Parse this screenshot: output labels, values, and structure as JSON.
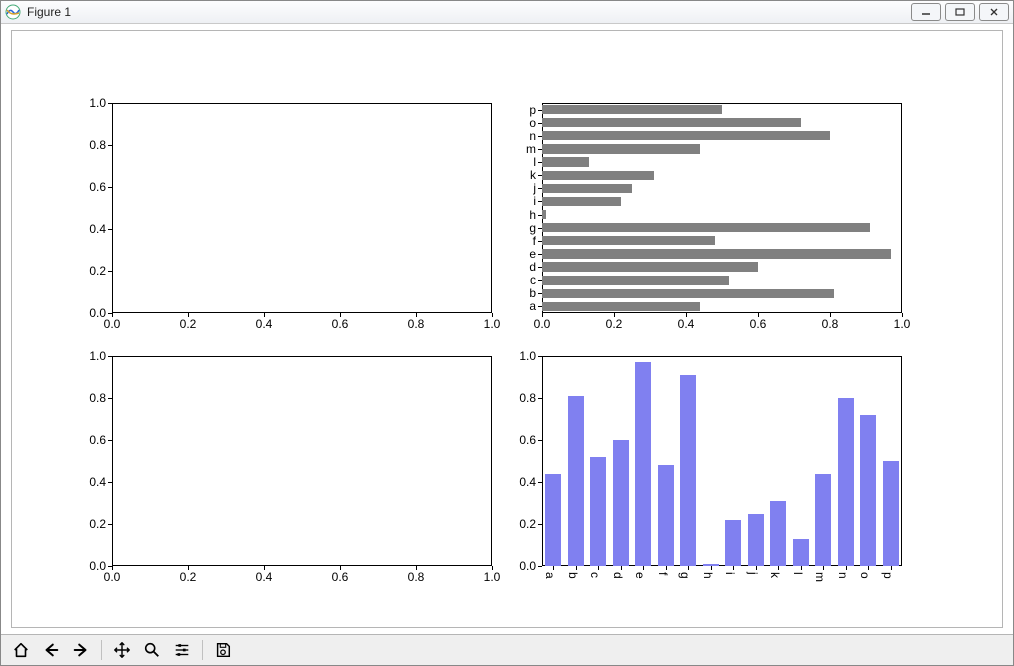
{
  "window": {
    "title": "Figure 1"
  },
  "toolbar": {
    "home": "Home",
    "back": "Back",
    "forward": "Forward",
    "pan": "Pan",
    "zoom": "Zoom",
    "configure": "Configure subplots",
    "save": "Save"
  },
  "empty_axes_ticks": {
    "x": [
      "0.0",
      "0.2",
      "0.4",
      "0.6",
      "0.8",
      "1.0"
    ],
    "y": [
      "0.0",
      "0.2",
      "0.4",
      "0.6",
      "0.8",
      "1.0"
    ]
  },
  "chart_data": [
    {
      "id": "top-left",
      "type": "empty",
      "xlim": [
        0.0,
        1.0
      ],
      "ylim": [
        0.0,
        1.0
      ],
      "xticks": [
        0.0,
        0.2,
        0.4,
        0.6,
        0.8,
        1.0
      ],
      "yticks": [
        0.0,
        0.2,
        0.4,
        0.6,
        0.8,
        1.0
      ]
    },
    {
      "id": "top-right",
      "type": "barh",
      "categories": [
        "a",
        "b",
        "c",
        "d",
        "e",
        "f",
        "g",
        "h",
        "i",
        "j",
        "k",
        "l",
        "m",
        "n",
        "o",
        "p"
      ],
      "values": [
        0.44,
        0.81,
        0.52,
        0.6,
        0.97,
        0.48,
        0.91,
        0.01,
        0.22,
        0.25,
        0.31,
        0.13,
        0.44,
        0.8,
        0.72,
        0.5
      ],
      "xlim": [
        0.0,
        1.0
      ],
      "xticks": [
        0.0,
        0.2,
        0.4,
        0.6,
        0.8,
        1.0
      ],
      "bar_color": "#808080",
      "title": "",
      "xlabel": "",
      "ylabel": ""
    },
    {
      "id": "bottom-left",
      "type": "empty",
      "xlim": [
        0.0,
        1.0
      ],
      "ylim": [
        0.0,
        1.0
      ],
      "xticks": [
        0.0,
        0.2,
        0.4,
        0.6,
        0.8,
        1.0
      ],
      "yticks": [
        0.0,
        0.2,
        0.4,
        0.6,
        0.8,
        1.0
      ]
    },
    {
      "id": "bottom-right",
      "type": "bar",
      "categories": [
        "a",
        "b",
        "c",
        "d",
        "e",
        "f",
        "g",
        "h",
        "i",
        "j",
        "k",
        "l",
        "m",
        "n",
        "o",
        "p"
      ],
      "values": [
        0.44,
        0.81,
        0.52,
        0.6,
        0.97,
        0.48,
        0.91,
        0.01,
        0.22,
        0.25,
        0.31,
        0.13,
        0.44,
        0.8,
        0.72,
        0.5
      ],
      "ylim": [
        0.0,
        1.0
      ],
      "yticks": [
        0.0,
        0.2,
        0.4,
        0.6,
        0.8,
        1.0
      ],
      "bar_color": "#8080f0",
      "title": "",
      "xlabel": "",
      "ylabel": ""
    }
  ]
}
